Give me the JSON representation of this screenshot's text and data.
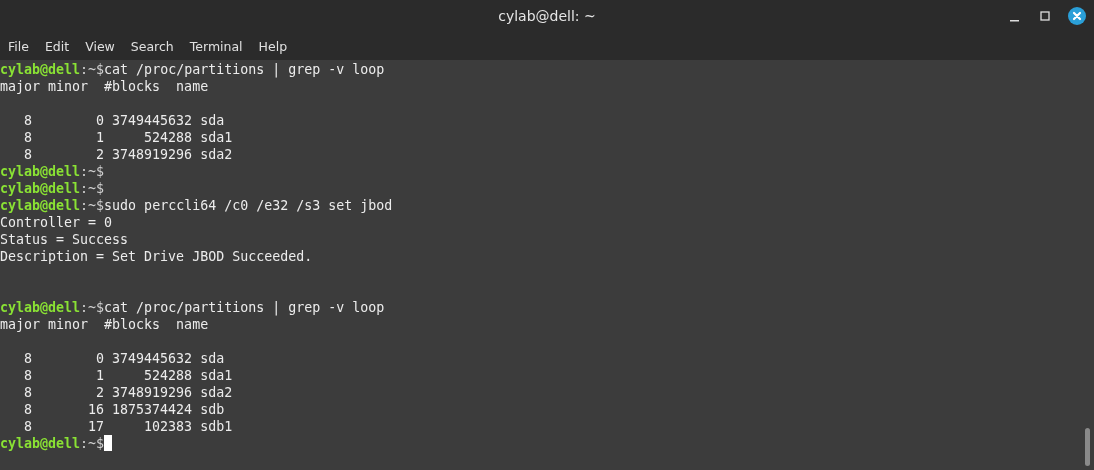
{
  "window": {
    "title": "cylab@dell: ~"
  },
  "menu": [
    {
      "label": "File"
    },
    {
      "label": "Edit"
    },
    {
      "label": "View"
    },
    {
      "label": "Search"
    },
    {
      "label": "Terminal"
    },
    {
      "label": "Help"
    }
  ],
  "terminal": {
    "lines": [
      {
        "kind": "prompt",
        "user": "cylab@dell",
        "suffix": ":~$",
        "command": "cat /proc/partitions | grep -v loop"
      },
      {
        "kind": "output",
        "text": "major minor  #blocks  name"
      },
      {
        "kind": "blank"
      },
      {
        "kind": "output",
        "text": "   8        0 3749445632 sda"
      },
      {
        "kind": "output",
        "text": "   8        1     524288 sda1"
      },
      {
        "kind": "output",
        "text": "   8        2 3748919296 sda2"
      },
      {
        "kind": "prompt",
        "user": "cylab@dell",
        "suffix": ":~$"
      },
      {
        "kind": "prompt",
        "user": "cylab@dell",
        "suffix": ":~$"
      },
      {
        "kind": "prompt",
        "user": "cylab@dell",
        "suffix": ":~$",
        "command": "sudo perccli64 /c0 /e32 /s3 set jbod"
      },
      {
        "kind": "output",
        "text": "Controller = 0"
      },
      {
        "kind": "output",
        "text": "Status = Success"
      },
      {
        "kind": "output",
        "text": "Description = Set Drive JBOD Succeeded."
      },
      {
        "kind": "blank"
      },
      {
        "kind": "blank"
      },
      {
        "kind": "prompt",
        "user": "cylab@dell",
        "suffix": ":~$",
        "command": "cat /proc/partitions | grep -v loop"
      },
      {
        "kind": "output",
        "text": "major minor  #blocks  name"
      },
      {
        "kind": "blank"
      },
      {
        "kind": "output",
        "text": "   8        0 3749445632 sda"
      },
      {
        "kind": "output",
        "text": "   8        1     524288 sda1"
      },
      {
        "kind": "output",
        "text": "   8        2 3748919296 sda2"
      },
      {
        "kind": "output",
        "text": "   8       16 1875374424 sdb"
      },
      {
        "kind": "output",
        "text": "   8       17     102383 sdb1"
      },
      {
        "kind": "prompt",
        "user": "cylab@dell",
        "suffix": ":~$"
      }
    ],
    "cursor": true
  }
}
